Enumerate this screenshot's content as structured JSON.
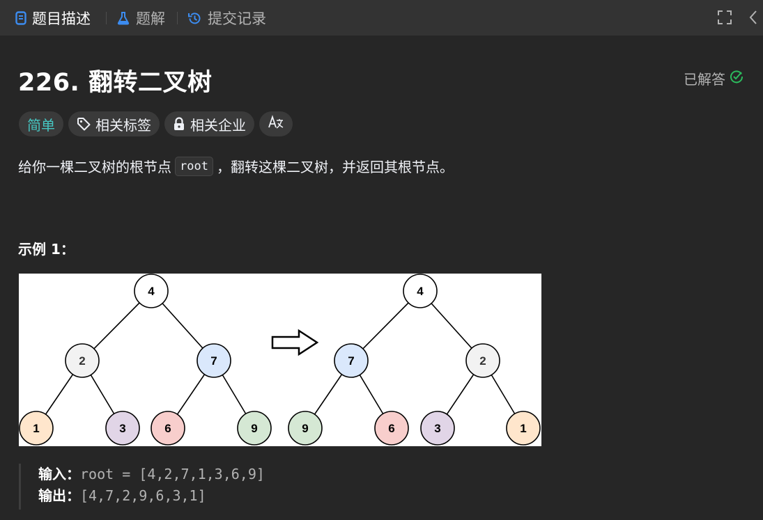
{
  "tabs": [
    {
      "label": "题目描述",
      "icon": "document-icon",
      "active": true
    },
    {
      "label": "题解",
      "icon": "flask-icon",
      "active": false
    },
    {
      "label": "提交记录",
      "icon": "history-icon",
      "active": false
    }
  ],
  "problem": {
    "title": "226. 翻转二叉树",
    "status": "已解答",
    "status_icon": "check-circle-icon",
    "difficulty": "简单",
    "tag_chips": {
      "topics": "相关标签",
      "companies": "相关企业",
      "translate": "Aあ"
    },
    "description": {
      "before": "给你一棵二叉树的根节点",
      "code": "root",
      "after": "，翻转这棵二叉树，并返回其根节点。"
    }
  },
  "example": {
    "title": "示例 1：",
    "input_label": "输入：",
    "input_value": "root = [4,2,7,1,3,6,9]",
    "output_label": "输出：",
    "output_value": "[4,7,2,9,6,3,1]",
    "tree_before": [
      "4",
      "2",
      "7",
      "1",
      "3",
      "6",
      "9"
    ],
    "tree_after": [
      "4",
      "7",
      "2",
      "9",
      "6",
      "3",
      "1"
    ]
  },
  "colors": {
    "accent_easy": "#46c6c2",
    "accent_tab_icon": "#3c8cf0",
    "solved": "#2cbb5d",
    "node_white": "#ffffff",
    "node_grey": "#f2f2f2",
    "node_blue": "#dae8fc",
    "node_orange": "#ffe6cc",
    "node_purple": "#e1d5e7",
    "node_red": "#f8cecc",
    "node_green": "#d5e8d4"
  }
}
